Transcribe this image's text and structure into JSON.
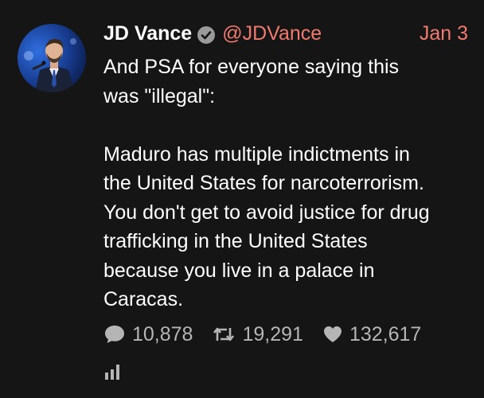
{
  "tweet": {
    "author_name": "JD Vance",
    "handle": "@JDVance",
    "date": "Jan 3",
    "verified_icon": "verified-badge-icon",
    "body_lines": [
      "And PSA for everyone saying this",
      "was \"illegal\":",
      "",
      "Maduro has multiple indictments in",
      "the United States for narcoterrorism.",
      "You don't get to avoid justice for drug",
      "trafficking in the United States",
      "because you live in a palace in",
      "Caracas."
    ],
    "stats": {
      "replies": "10,878",
      "retweets": "19,291",
      "likes": "132,617"
    },
    "icons": {
      "reply": "speech-bubble-icon",
      "retweet": "retweet-icon",
      "like": "heart-icon",
      "analytics": "bar-chart-icon"
    },
    "colors": {
      "background": "#151515",
      "accent": "#f07a6e",
      "muted": "#b5b5b5",
      "text": "#ffffff"
    }
  }
}
